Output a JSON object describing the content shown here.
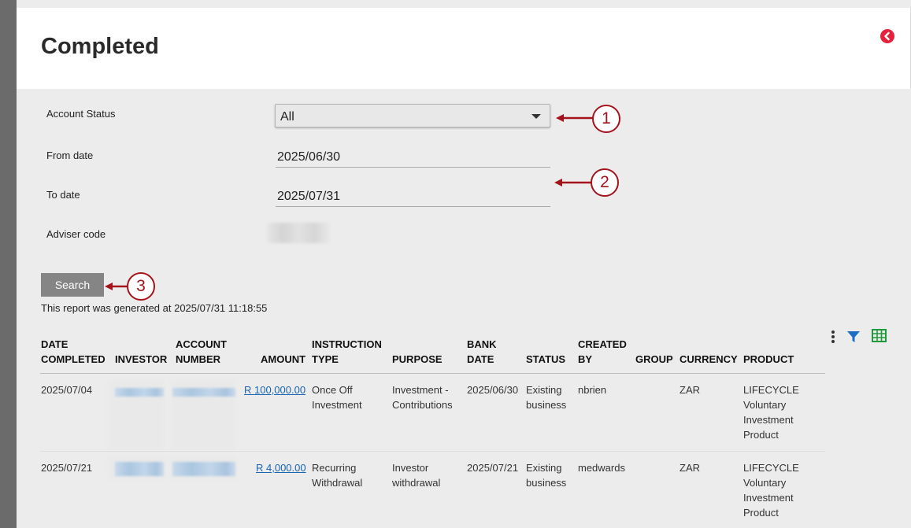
{
  "page": {
    "title": "Completed"
  },
  "filters": {
    "account_status_label": "Account Status",
    "account_status_value": "All",
    "from_date_label": "From date",
    "from_date_value": "2025/06/30",
    "to_date_label": "To date",
    "to_date_value": "2025/07/31",
    "adviser_code_label": "Adviser code"
  },
  "search_label": "Search",
  "report_note": "This report was generated at 2025/07/31 11:18:55",
  "annotations": [
    "1",
    "2",
    "3"
  ],
  "table": {
    "headers": {
      "date_completed": [
        "DATE",
        "COMPLETED"
      ],
      "investor": "INVESTOR",
      "account_number": [
        "ACCOUNT",
        "NUMBER"
      ],
      "amount": "AMOUNT",
      "instruction_type": [
        "INSTRUCTION",
        "TYPE"
      ],
      "purpose": "PURPOSE",
      "bank_date": [
        "BANK",
        "DATE"
      ],
      "status": "STATUS",
      "created_by": [
        "CREATED",
        "BY"
      ],
      "group": "GROUP",
      "currency": "CURRENCY",
      "product": "PRODUCT"
    },
    "rows": [
      {
        "date_completed": "2025/07/04",
        "amount": "R 100,000.00",
        "instruction_type": [
          "Once Off",
          "Investment"
        ],
        "purpose": [
          "Investment -",
          "Contributions"
        ],
        "bank_date": "2025/06/30",
        "status": [
          "Existing",
          "business"
        ],
        "created_by": "nbrien",
        "group": "",
        "currency": "ZAR",
        "product": [
          "LIFECYCLE",
          "Voluntary",
          "Investment",
          "Product"
        ]
      },
      {
        "date_completed": "2025/07/21",
        "amount": "R 4,000.00",
        "instruction_type": [
          "Recurring",
          "Withdrawal"
        ],
        "purpose": [
          "Investor",
          "withdrawal"
        ],
        "bank_date": "2025/07/21",
        "status": [
          "Existing",
          "business"
        ],
        "created_by": "medwards",
        "group": "",
        "currency": "ZAR",
        "product": [
          "LIFECYCLE",
          "Voluntary",
          "Investment",
          "Product"
        ]
      }
    ]
  },
  "colors": {
    "accent_red": "#a4131c",
    "close_icon": "#e6213c",
    "link_blue": "#1a64b4",
    "filter_icon": "#1a6fc4",
    "grid_icon": "#1e9a3a"
  },
  "icons": {
    "close": "chevron-left-circle-icon",
    "more": "kebab-menu-icon",
    "filter": "filter-icon",
    "export": "spreadsheet-icon"
  }
}
